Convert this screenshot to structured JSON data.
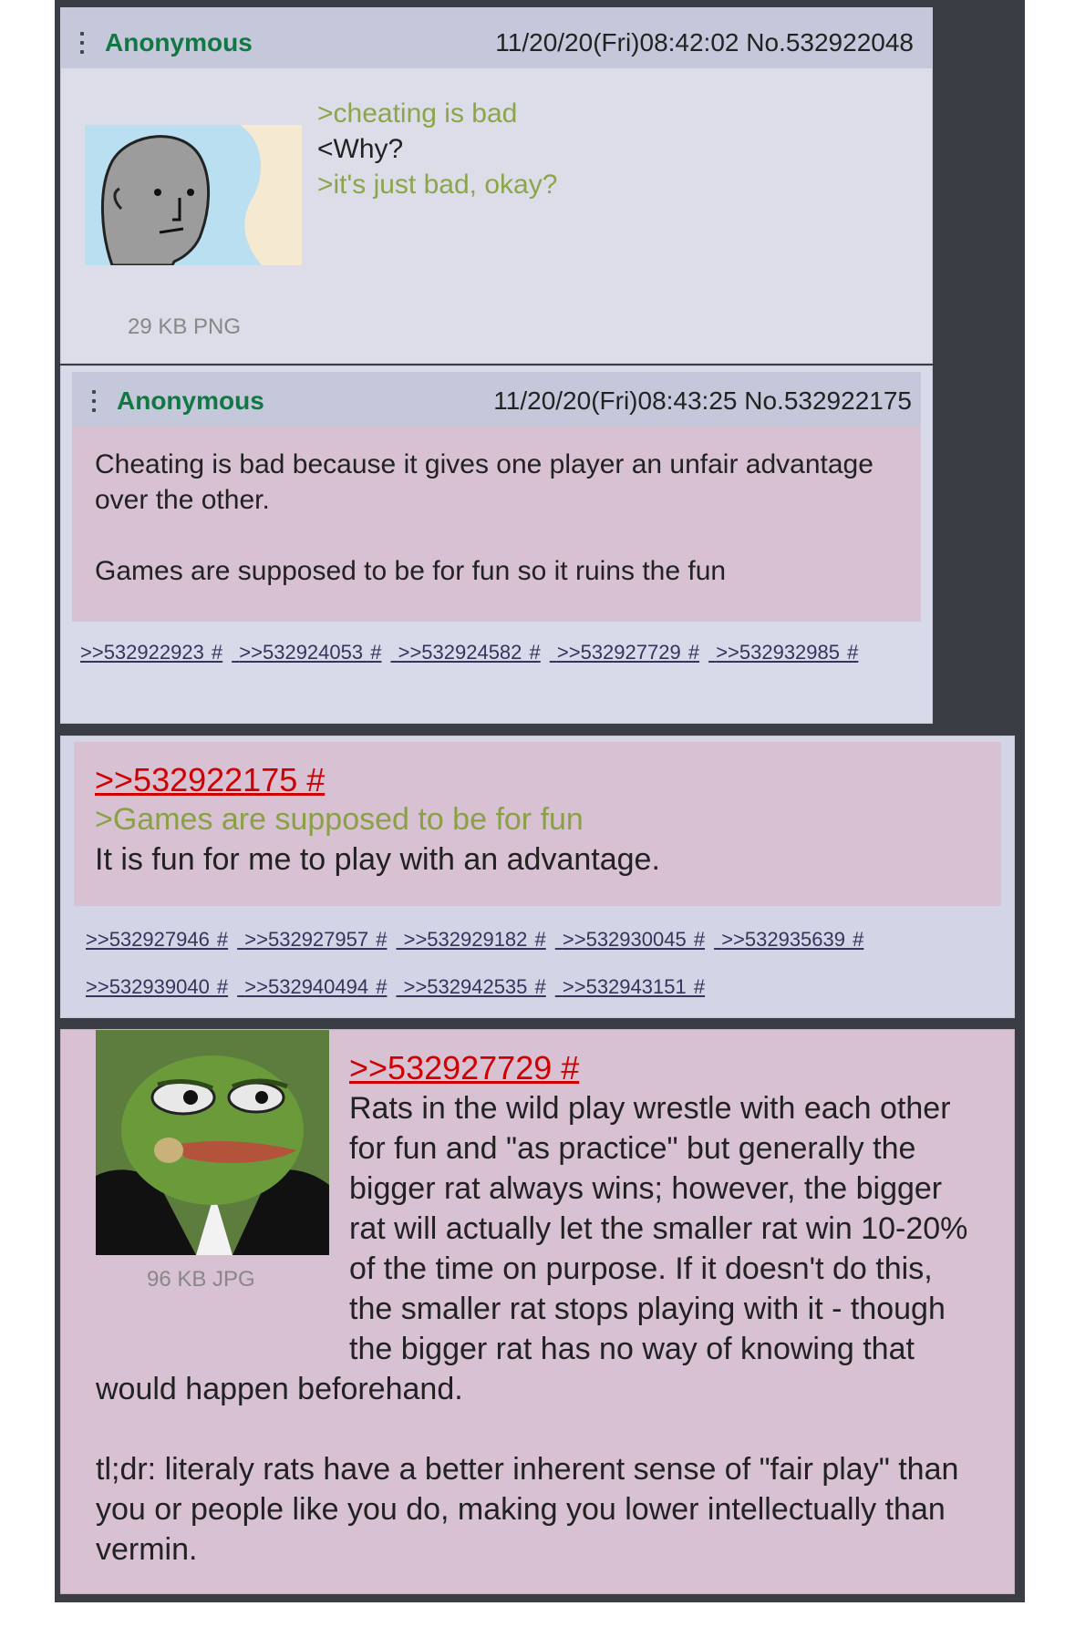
{
  "posts": [
    {
      "name": "Anonymous",
      "datetime": "11/20/20(Fri)08:42:02 No.532922048",
      "lines": [
        ">cheating is bad",
        "<Why?",
        ">it's just bad, okay?"
      ],
      "file_info": "29 KB PNG",
      "thumbnail": "npc-wojak-thumbnail"
    },
    {
      "name": "Anonymous",
      "datetime": "11/20/20(Fri)08:43:25 No.532922175",
      "paragraphs": [
        "Cheating is bad because it gives one player an unfair advantage over the other.",
        "Games are supposed to be for fun so it ruins the fun"
      ],
      "backlinks": [
        ">>532922923 #",
        ">>532924053 #",
        ">>532924582 #",
        ">>532927729 #",
        ">>532932985 #"
      ]
    },
    {
      "quote": ">>532922175 #",
      "greentext": ">Games are supposed to be for fun",
      "text": "It is fun for me to play with an advantage.",
      "backlinks": [
        ">>532927946 #",
        ">>532927957 #",
        ">>532929182 #",
        ">>532930045 #",
        ">>532935639 #",
        ">>532939040 #",
        ">>532940494 #",
        ">>532942535 #",
        ">>532943151 #"
      ]
    },
    {
      "quote": ">>532927729 #",
      "paragraph1": "Rats in the wild play wrestle with each other for fun and \"as practice\" but generally the bigger rat always wins; however, the bigger rat will actually let the smaller rat win 10-20% of the time on purpose. If it doesn't do this, the smaller rat stops playing with it - though the bigger rat has no way of knowing that would happen beforehand.",
      "paragraph2": "tl;dr: literaly rats have a better inherent sense of \"fair play\" than you or people like you do, making you lower intellectually than vermin.",
      "file_info": "96 KB JPG",
      "thumbnail": "pepe-frog-thumbnail"
    }
  ],
  "colors": {
    "name": "#117743",
    "greentext": "#789922",
    "quote_link": "#d00000",
    "backlink": "#34345c",
    "post_bg": "#d6daf0",
    "highlight_bg": "#d7c1d3"
  }
}
